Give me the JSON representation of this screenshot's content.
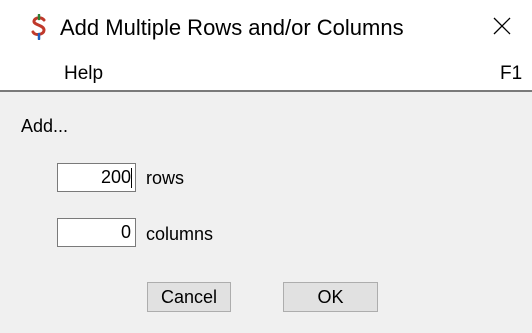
{
  "window": {
    "title": "Add Multiple Rows and/or Columns",
    "icon": "dollar-s-icon",
    "close_icon": "close-icon",
    "icon_color": "#c0392b",
    "icon_accent_color": "#2e7d32"
  },
  "menu": {
    "items": [
      {
        "label": "Help",
        "shortcut": "F1"
      }
    ]
  },
  "form": {
    "heading": "Add...",
    "rows": {
      "value": "200",
      "label": "rows"
    },
    "columns": {
      "value": "0",
      "label": "columns"
    }
  },
  "buttons": {
    "cancel": "Cancel",
    "ok": "OK"
  }
}
